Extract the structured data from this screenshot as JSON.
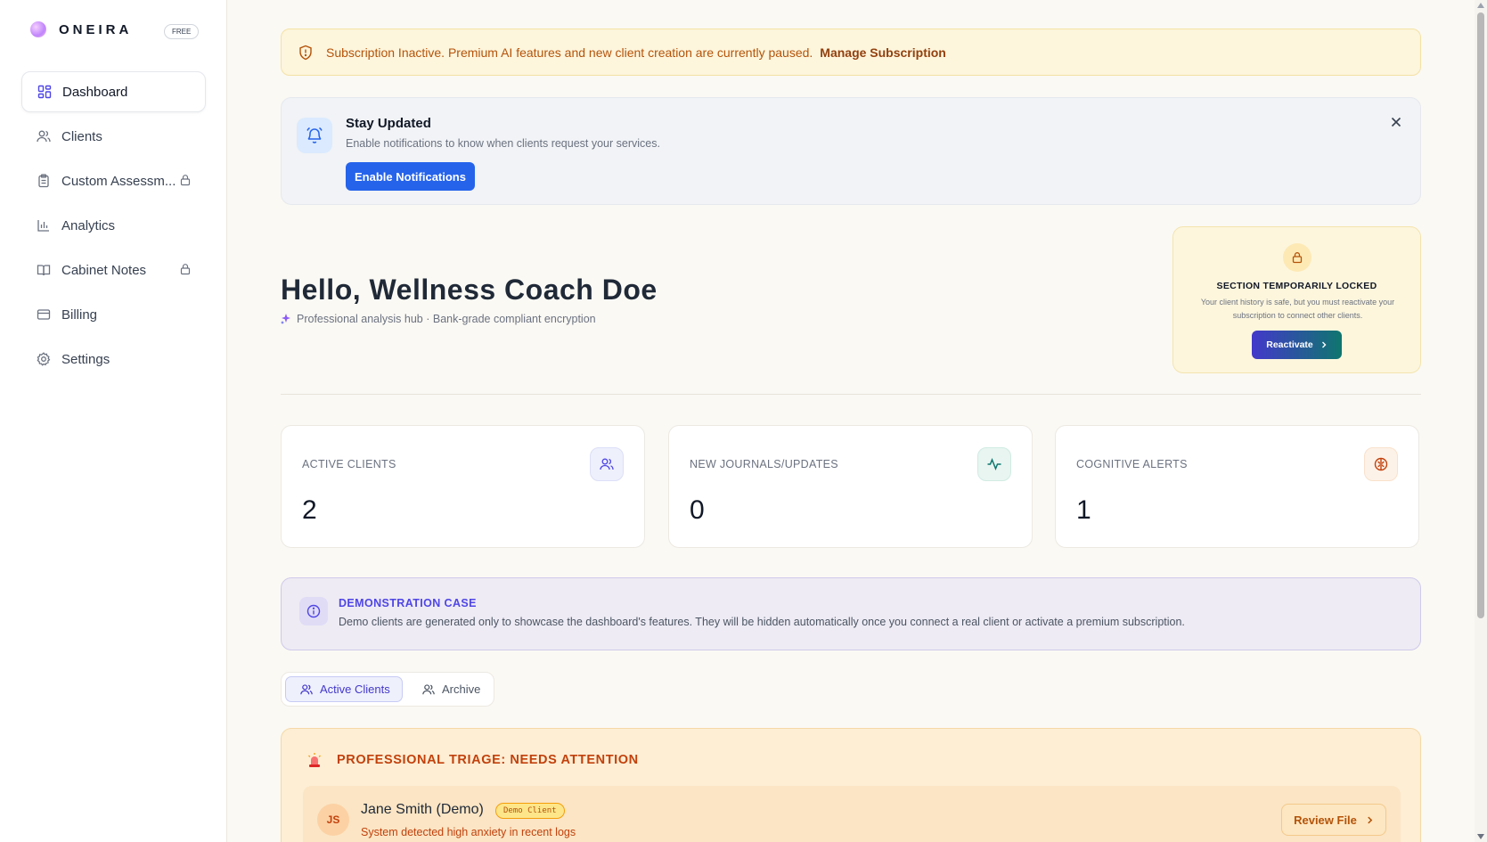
{
  "brand": {
    "name": "ONEIRA",
    "plan": "FREE"
  },
  "sidebar": {
    "items": [
      {
        "label": "Dashboard",
        "icon": "dashboard-icon",
        "locked": false,
        "active": true
      },
      {
        "label": "Clients",
        "icon": "users-icon",
        "locked": false
      },
      {
        "label": "Custom Assessm...",
        "icon": "clipboard-icon",
        "locked": true
      },
      {
        "label": "Analytics",
        "icon": "bar-chart-icon",
        "locked": false
      },
      {
        "label": "Cabinet Notes",
        "icon": "book-icon",
        "locked": true
      },
      {
        "label": "Billing",
        "icon": "credit-card-icon",
        "locked": false
      },
      {
        "label": "Settings",
        "icon": "gear-icon",
        "locked": false
      }
    ]
  },
  "banner": {
    "text": "Subscription Inactive. Premium AI features and new client creation are currently paused.",
    "link": "Manage Subscription"
  },
  "notification": {
    "title": "Stay Updated",
    "subtitle": "Enable notifications to know when clients request your services.",
    "button": "Enable Notifications"
  },
  "greeting": {
    "title": "Hello, Wellness Coach Doe",
    "subtitle": "Professional analysis hub · Bank-grade compliant encryption"
  },
  "locked_section": {
    "title": "SECTION TEMPORARILY LOCKED",
    "description": "Your client history is safe, but you must reactivate your subscription to connect other clients.",
    "button": "Reactivate"
  },
  "stats": [
    {
      "label": "ACTIVE CLIENTS",
      "value": "2",
      "icon": "users-icon",
      "color": "#4f46e5"
    },
    {
      "label": "NEW JOURNALS/UPDATES",
      "value": "0",
      "icon": "activity-icon",
      "color": "#0f766e"
    },
    {
      "label": "COGNITIVE ALERTS",
      "value": "1",
      "icon": "brain-icon",
      "color": "#c2410c"
    }
  ],
  "demo_case": {
    "title": "DEMONSTRATION CASE",
    "text": "Demo clients are generated only to showcase the dashboard's features. They will be hidden automatically once you connect a real client or activate a premium subscription."
  },
  "tabs": [
    {
      "label": "Active Clients",
      "active": true
    },
    {
      "label": "Archive",
      "active": false
    }
  ],
  "triage": {
    "title": "PROFESSIONAL TRIAGE: NEEDS ATTENTION",
    "client": {
      "initials": "JS",
      "name": "Jane Smith (Demo)",
      "badge": "Demo Client",
      "description": "System detected high anxiety in recent logs",
      "button": "Review File"
    }
  },
  "colors": {
    "accent": "#2563eb",
    "warning": "#b45309",
    "demo": "#4f46e5",
    "triage": "#c2410c"
  }
}
